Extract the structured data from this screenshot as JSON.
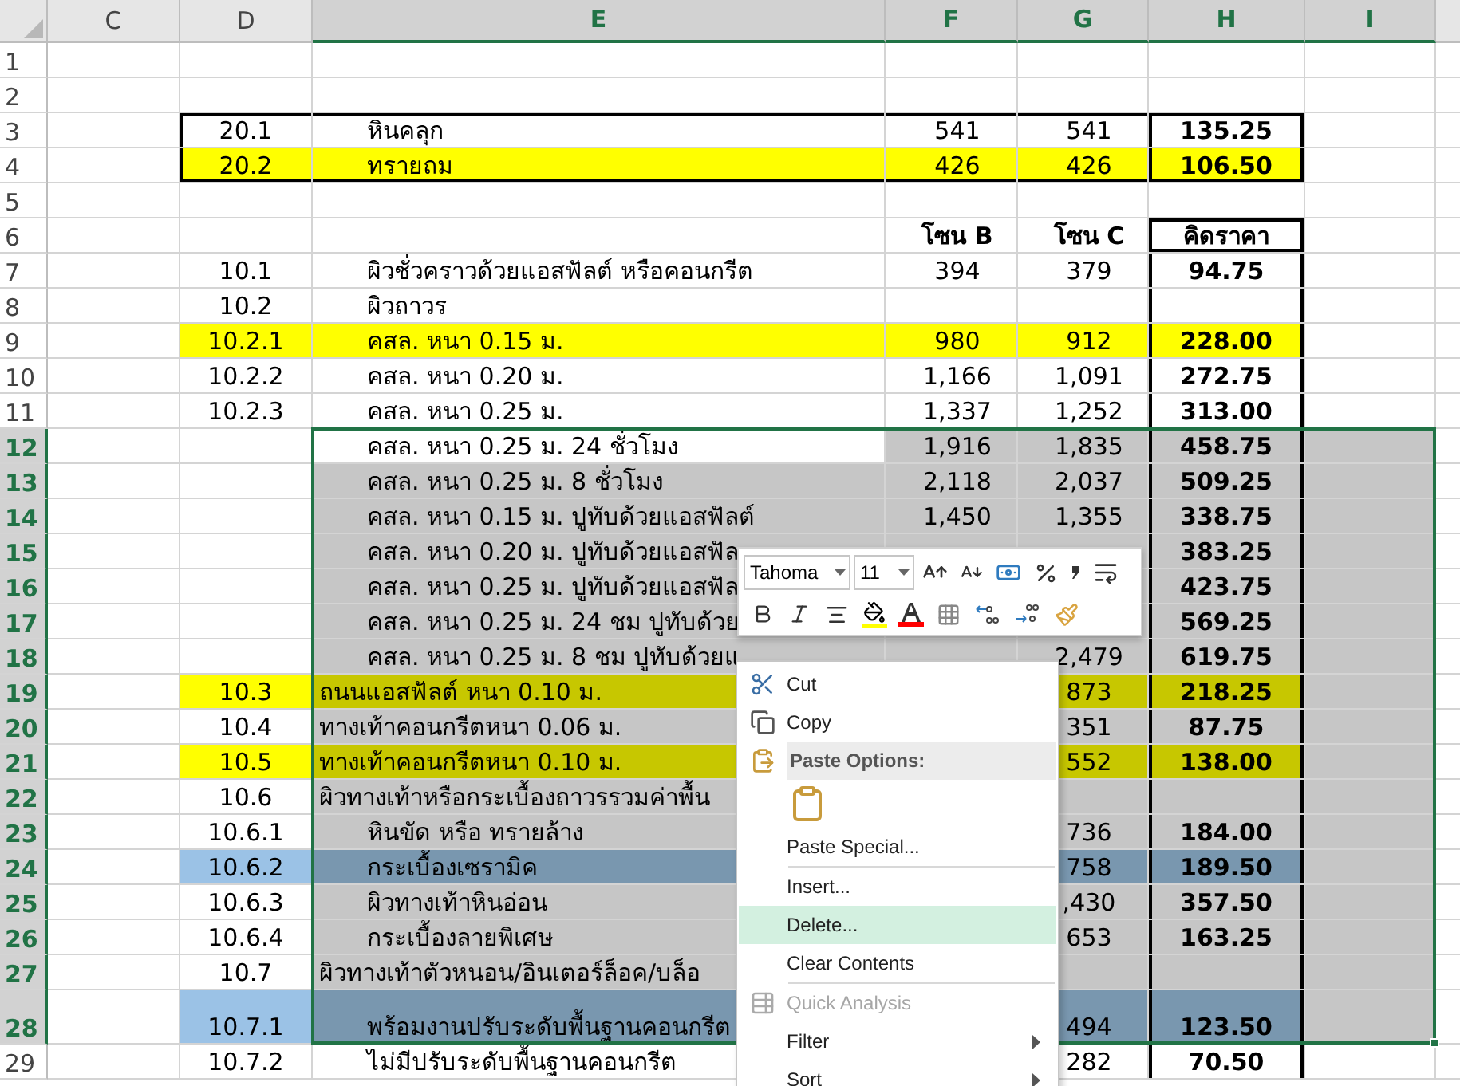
{
  "columns": [
    {
      "label": "C",
      "selected": false
    },
    {
      "label": "D",
      "selected": false
    },
    {
      "label": "E",
      "selected": true
    },
    {
      "label": "F",
      "selected": true
    },
    {
      "label": "G",
      "selected": true
    },
    {
      "label": "H",
      "selected": true
    },
    {
      "label": "I",
      "selected": true
    }
  ],
  "rows": [
    {
      "num": "1",
      "selected": false
    },
    {
      "num": "2",
      "selected": false
    },
    {
      "num": "3",
      "selected": false,
      "frame_top": true,
      "h_frame": true,
      "d": "20.1",
      "e": "หินคลุก",
      "e_indent": true,
      "f": "541",
      "g": "541",
      "h": "135.25"
    },
    {
      "num": "4",
      "selected": false,
      "frame_bottom": true,
      "h_frame": true,
      "color": "#ffff00",
      "d": "20.2",
      "e": "ทรายถม",
      "e_indent": true,
      "f": "426",
      "g": "426",
      "h": "106.50"
    },
    {
      "num": "5",
      "selected": false
    },
    {
      "num": "6",
      "selected": false,
      "h_box": true,
      "h_frame": true,
      "f": "โซน B",
      "g": "โซน C",
      "h": "คิดราคา"
    },
    {
      "num": "7",
      "selected": false,
      "h_frame": true,
      "d": "10.1",
      "e": "ผิวชั่วคราวด้วยแอสฟัลต์ หรือคอนกรีต",
      "e_indent": true,
      "f": "394",
      "g": "379",
      "h": "94.75"
    },
    {
      "num": "8",
      "selected": false,
      "h_frame": true,
      "d": "10.2",
      "e": "ผิวถาวร",
      "e_indent": true
    },
    {
      "num": "9",
      "selected": false,
      "h_frame": true,
      "color": "#ffff00",
      "d": "10.2.1",
      "e": "คสล. หนา 0.15 ม.",
      "e_indent": true,
      "f": "980",
      "g": "912",
      "h": "228.00"
    },
    {
      "num": "10",
      "selected": false,
      "h_frame": true,
      "d": "10.2.2",
      "e": "คสล. หนา 0.20 ม.",
      "e_indent": true,
      "f": "1,166",
      "g": "1,091",
      "h": "272.75"
    },
    {
      "num": "11",
      "selected": false,
      "h_frame": true,
      "d": "10.2.3",
      "e": "คสล. หนา 0.25 ม.",
      "e_indent": true,
      "f": "1,337",
      "g": "1,252",
      "h": "313.00"
    },
    {
      "num": "12",
      "selected": true,
      "active": true,
      "h_frame": true,
      "e": "คสล. หนา 0.25 ม. 24 ชั่วโมง",
      "e_indent": true,
      "f": "1,916",
      "g": "1,835",
      "h": "458.75"
    },
    {
      "num": "13",
      "selected": true,
      "active": false,
      "h_frame": true,
      "e": "คสล. หนา 0.25 ม. 8 ชั่วโมง",
      "e_indent": true,
      "f": "2,118",
      "g": "2,037",
      "h": "509.25"
    },
    {
      "num": "14",
      "selected": true,
      "active": false,
      "h_frame": true,
      "e": "คสล. หนา 0.15 ม. ปูทับด้วยแอสฟัลต์",
      "e_indent": true,
      "f": "1,450",
      "g": "1,355",
      "h": "338.75"
    },
    {
      "num": "15",
      "selected": true,
      "active": false,
      "h_frame": true,
      "e": "คสล. หนา 0.20 ม. ปูทับด้วยแอสฟัล",
      "e_indent": true,
      "h": "383.25"
    },
    {
      "num": "16",
      "selected": true,
      "active": false,
      "h_frame": true,
      "e": "คสล. หนา 0.25 ม. ปูทับด้วยแอสฟัล",
      "e_indent": true,
      "h": "423.75"
    },
    {
      "num": "17",
      "selected": true,
      "active": false,
      "h_frame": true,
      "e": "คสล. หนา 0.25 ม. 24 ชม ปูทับด้วย",
      "e_indent": true,
      "h": "569.25"
    },
    {
      "num": "18",
      "selected": true,
      "active": false,
      "h_frame": true,
      "e": "คสล. หนา 0.25 ม. 8 ชม ปูทับด้วยแ",
      "e_indent": true,
      "g": "2,479",
      "h": "619.75"
    },
    {
      "num": "19",
      "selected": true,
      "active": false,
      "h_frame": true,
      "color": "#ffff00",
      "d": "10.3",
      "e": "ถนนแอสฟัลต์ หนา 0.10 ม.",
      "e_indent": false,
      "g": "873",
      "h": "218.25"
    },
    {
      "num": "20",
      "selected": true,
      "active": false,
      "h_frame": true,
      "d": "10.4",
      "e": "ทางเท้าคอนกรีตหนา 0.06 ม.",
      "e_indent": false,
      "g": "351",
      "h": "87.75"
    },
    {
      "num": "21",
      "selected": true,
      "active": false,
      "h_frame": true,
      "color": "#ffff00",
      "d": "10.5",
      "e": "ทางเท้าคอนกรีตหนา 0.10 ม.",
      "e_indent": false,
      "g": "552",
      "h": "138.00"
    },
    {
      "num": "22",
      "selected": true,
      "active": false,
      "h_frame": true,
      "d": "10.6",
      "e": "ผิวทางเท้าหรือกระเบื้องถาวรรวมค่าพื้น",
      "e_indent": false
    },
    {
      "num": "23",
      "selected": true,
      "active": false,
      "h_frame": true,
      "d": "10.6.1",
      "e": "หินขัด หรือ ทรายล้าง",
      "e_indent": true,
      "g": "736",
      "h": "184.00"
    },
    {
      "num": "24",
      "selected": true,
      "active": false,
      "h_frame": true,
      "color": "#9bc2e6",
      "d": "10.6.2",
      "e": "กระเบื้องเซรามิค",
      "e_indent": true,
      "g": "758",
      "h": "189.50"
    },
    {
      "num": "25",
      "selected": true,
      "active": false,
      "h_frame": true,
      "d": "10.6.3",
      "e": "ผิวทางเท้าหินอ่อน",
      "e_indent": true,
      "g": ",430",
      "h": "357.50"
    },
    {
      "num": "26",
      "selected": true,
      "active": false,
      "h_frame": true,
      "d": "10.6.4",
      "e": "กระเบื้องลายพิเศษ",
      "e_indent": true,
      "g": "653",
      "h": "163.25"
    },
    {
      "num": "27",
      "selected": true,
      "active": false,
      "h_frame": true,
      "d": "10.7",
      "e": "ผิวทางเท้าตัวหนอน/อินเตอร์ล็อค/บล็อ",
      "e_indent": false
    },
    {
      "num": "28",
      "selected": true,
      "active": false,
      "tall": true,
      "h_frame": true,
      "color": "#9bc2e6",
      "d": "10.7.1",
      "e": "พร้อมงานปรับระดับพื้นฐานคอนกรีต",
      "e_indent": true,
      "g": "494",
      "h": "123.50"
    },
    {
      "num": "29",
      "selected": false,
      "h_frame": true,
      "d": "10.7.2",
      "e": "ไม่มีปรับระดับพื้นฐานคอนกรีต",
      "e_indent": true,
      "g": "282",
      "h": "70.50"
    }
  ],
  "toolbar": {
    "font": "Tahoma",
    "size": "11",
    "swatches": [
      {
        "color": "#ffff00"
      },
      {
        "color": "#ff0000"
      }
    ]
  },
  "menu": [
    {
      "kind": "item",
      "label": "Cut",
      "disabled": false,
      "selected": false,
      "submenu": false
    },
    {
      "kind": "item",
      "label": "Copy",
      "disabled": false,
      "selected": false,
      "submenu": false
    },
    {
      "kind": "header",
      "label": "Paste Options:"
    },
    {
      "kind": "paste_options"
    },
    {
      "kind": "item",
      "label": "Paste Special...",
      "disabled": false,
      "selected": false,
      "submenu": false
    },
    {
      "kind": "separator"
    },
    {
      "kind": "item",
      "label": "Insert...",
      "disabled": false,
      "selected": false,
      "submenu": false
    },
    {
      "kind": "item",
      "label": "Delete...",
      "disabled": false,
      "selected": true,
      "submenu": false
    },
    {
      "kind": "item",
      "label": "Clear Contents",
      "disabled": false,
      "selected": false,
      "submenu": false
    },
    {
      "kind": "separator"
    },
    {
      "kind": "item",
      "label": "Quick Analysis",
      "disabled": true,
      "selected": false,
      "submenu": false
    },
    {
      "kind": "item",
      "label": "Filter",
      "disabled": false,
      "selected": false,
      "submenu": true
    },
    {
      "kind": "item",
      "label": "Sort",
      "disabled": false,
      "selected": false,
      "submenu": true
    }
  ]
}
